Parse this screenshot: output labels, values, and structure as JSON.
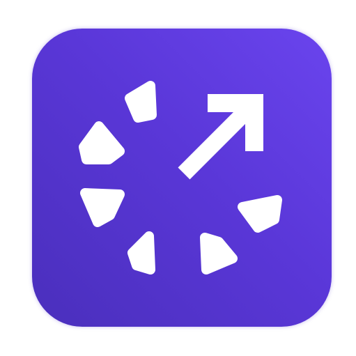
{
  "app_icon": {
    "name": "share-progress-app-icon",
    "icon": "arrow-up-right-dotted-circle-icon",
    "colors": {
      "background_start": "#4a2fbc",
      "background_end": "#6a44ee",
      "glyph": "#ffffff"
    }
  }
}
